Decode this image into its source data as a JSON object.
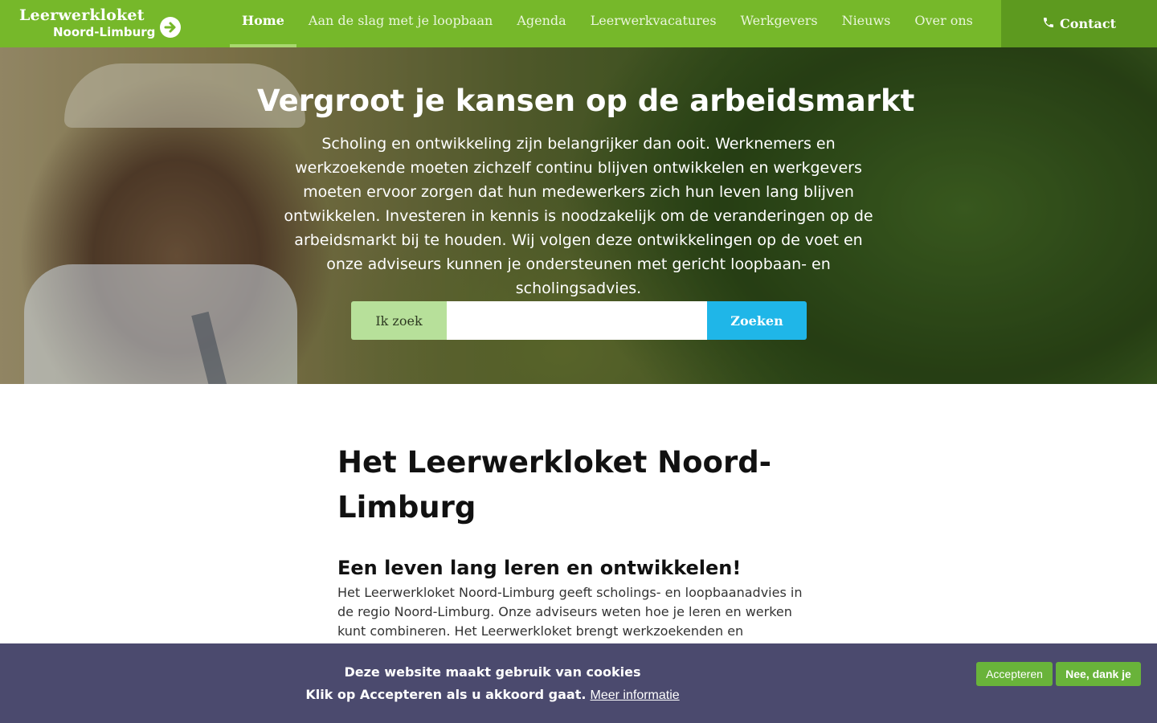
{
  "logo": {
    "line1": "Leerwerkloket",
    "line2": "Noord-Limburg",
    "icon": "arrow-right-circle-icon"
  },
  "nav": {
    "items": [
      {
        "label": "Home",
        "active": true
      },
      {
        "label": "Aan de slag met je loopbaan",
        "active": false
      },
      {
        "label": "Agenda",
        "active": false
      },
      {
        "label": "Leerwerkvacatures",
        "active": false
      },
      {
        "label": "Werkgevers",
        "active": false
      },
      {
        "label": "Nieuws",
        "active": false
      },
      {
        "label": "Over ons",
        "active": false
      }
    ],
    "contact": {
      "label": "Contact",
      "icon": "phone-icon"
    }
  },
  "hero": {
    "title": "Vergroot je kansen op de arbeidsmarkt",
    "text": "Scholing en ontwikkeling zijn belangrijker dan ooit. Werknemers en werkzoekende moeten zichzelf continu blijven ontwikkelen en werkgevers moeten ervoor zorgen dat hun medewerkers zich hun leven lang blijven ontwikkelen. Investeren in kennis is noodzakelijk om de veranderingen op de arbeidsmarkt bij te houden. Wij volgen deze ontwikkelingen op de voet en onze adviseurs kunnen je ondersteunen met gericht loopbaan- en scholingsadvies.",
    "search": {
      "label": "Ik zoek",
      "value": "",
      "placeholder": "",
      "button": "Zoeken"
    }
  },
  "main": {
    "title": "Het Leerwerkloket Noord-Limburg",
    "subtitle": "Een leven lang leren en ontwikkelen!",
    "text": "Het Leerwerkloket Noord-Limburg geeft scholings- en loopbaanadvies in de regio Noord-Limburg. Onze adviseurs weten hoe je leren en werken kunt combineren. Het Leerwerkloket brengt werkzoekenden en werkgevers bij elkaar"
  },
  "cookie": {
    "line1": "Deze website maakt gebruik van cookies",
    "line2": "Klik op Accepteren als u akkoord gaat.",
    "more_link": "Meer informatie",
    "accept": "Accepteren",
    "decline": "Nee, dank je"
  },
  "colors": {
    "header_green": "#76b82a",
    "contact_green": "#5d9a1f",
    "search_blue": "#1fb6e8",
    "cookie_bg": "#4b4a6e",
    "cookie_button": "#69b33a"
  }
}
